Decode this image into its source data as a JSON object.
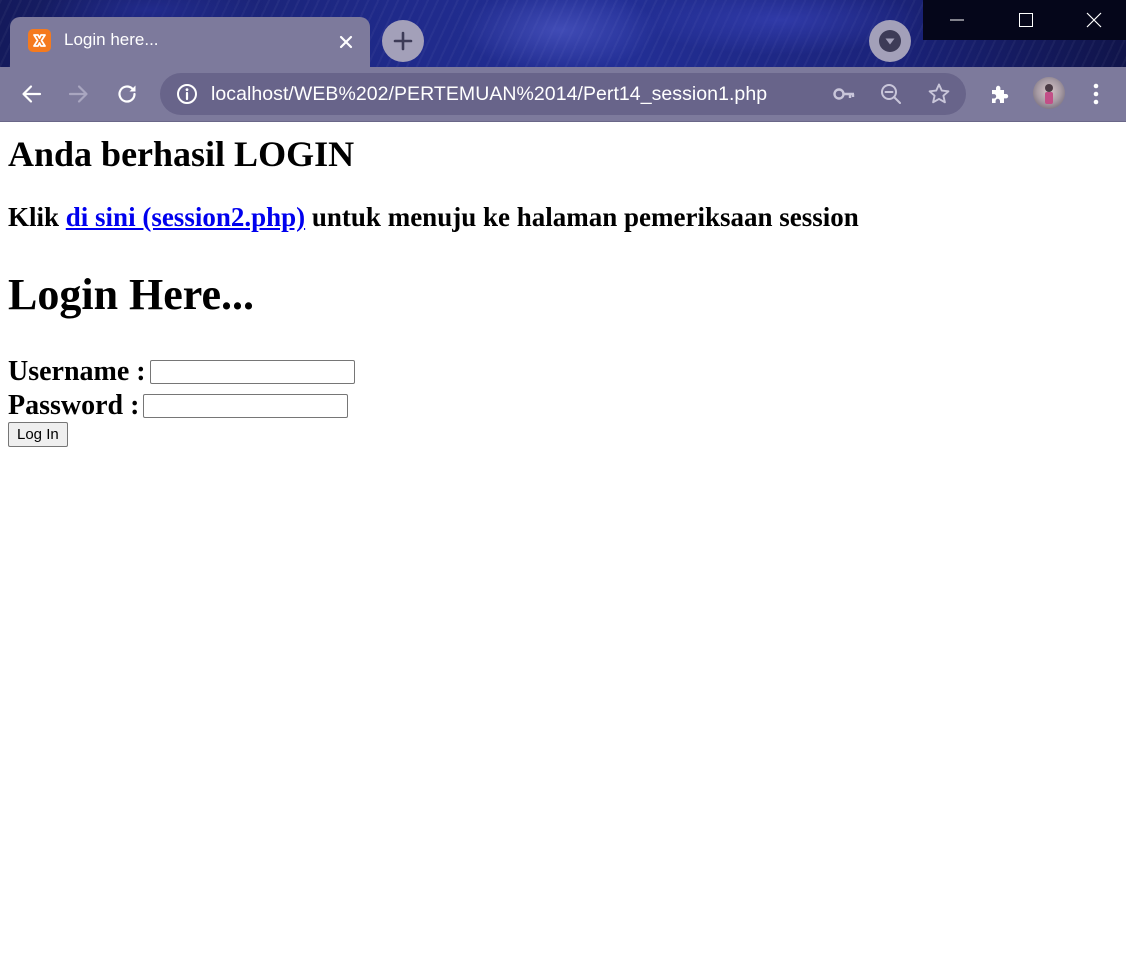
{
  "browser": {
    "tab": {
      "title": "Login here...",
      "favicon": "xampp-icon"
    },
    "address_bar": {
      "url": "localhost/WEB%202/PERTEMUAN%2014/Pert14_session1.php"
    },
    "colors": {
      "frame": "#7d7a9c",
      "omnibox": "#68648a",
      "favicon": "#f57a1e"
    }
  },
  "page": {
    "status_heading": "Anda berhasil LOGIN",
    "link_prefix": "Klik",
    "link_text": "di sini (session2.php)",
    "link_suffix": "untuk menuju ke halaman pemeriksaan session",
    "login_heading": "Login Here...",
    "username_label": "Username :",
    "username_value": "",
    "password_label": "Password :",
    "password_value": "",
    "login_button": "Log In"
  }
}
